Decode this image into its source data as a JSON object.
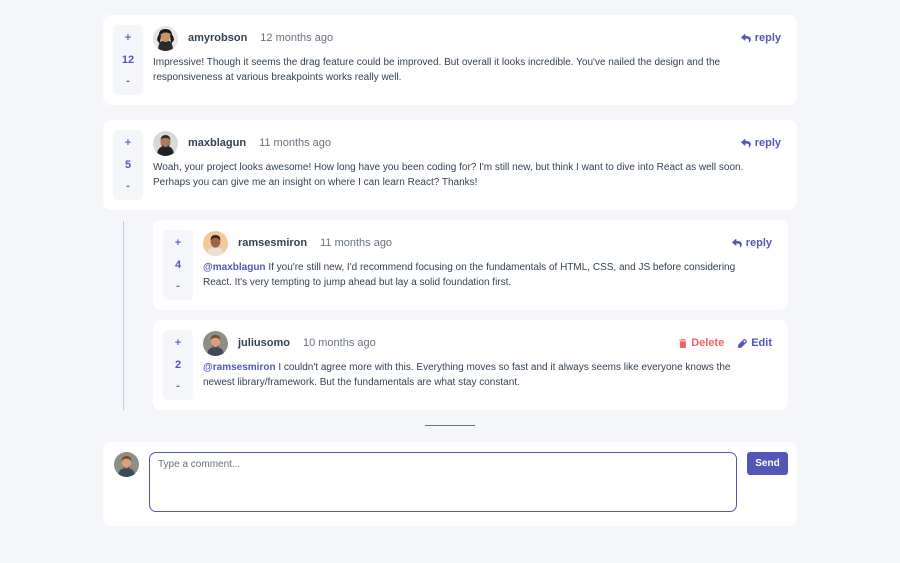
{
  "colors": {
    "accent": "#5357b6",
    "delete": "#ed6368",
    "background": "#f5f6fa",
    "card": "#ffffff",
    "text_dark": "#334253",
    "text_muted": "#67727e"
  },
  "vote_labels": {
    "up": "+",
    "down": "-"
  },
  "comments": [
    {
      "username": "amyrobson",
      "time": "12 months ago",
      "score": "12",
      "action": "reply",
      "content": "Impressive! Though it seems the drag feature could be improved. But overall it looks incredible. You've nailed the design and the responsiveness at various breakpoints works really well."
    },
    {
      "username": "maxblagun",
      "time": "11 months ago",
      "score": "5",
      "action": "reply",
      "content": "Woah, your project looks awesome! How long have you been coding for? I'm still new, but think I want to dive into React as well soon. Perhaps you can give me an insight on where I can learn React? Thanks!"
    }
  ],
  "replies": [
    {
      "username": "ramsesmiron",
      "time": "11 months ago",
      "score": "4",
      "action": "reply",
      "mention": "@maxblagun",
      "content": " If you're still new, I'd recommend focusing on the fundamentals of HTML, CSS, and JS before considering React. It's very tempting to jump ahead but lay a solid foundation first."
    },
    {
      "username": "juliusomo",
      "time": "10 months ago",
      "score": "2",
      "delete_label": "Delete",
      "edit_label": "Edit",
      "mention": "@ramsesmiron",
      "content": " I couldn't agree more with this. Everything moves so fast and it always seems like everyone knows the newest library/framework. But the fundamentals are what stay constant."
    }
  ],
  "compose": {
    "placeholder": "Type a comment...",
    "value": "",
    "send_label": "Send"
  }
}
